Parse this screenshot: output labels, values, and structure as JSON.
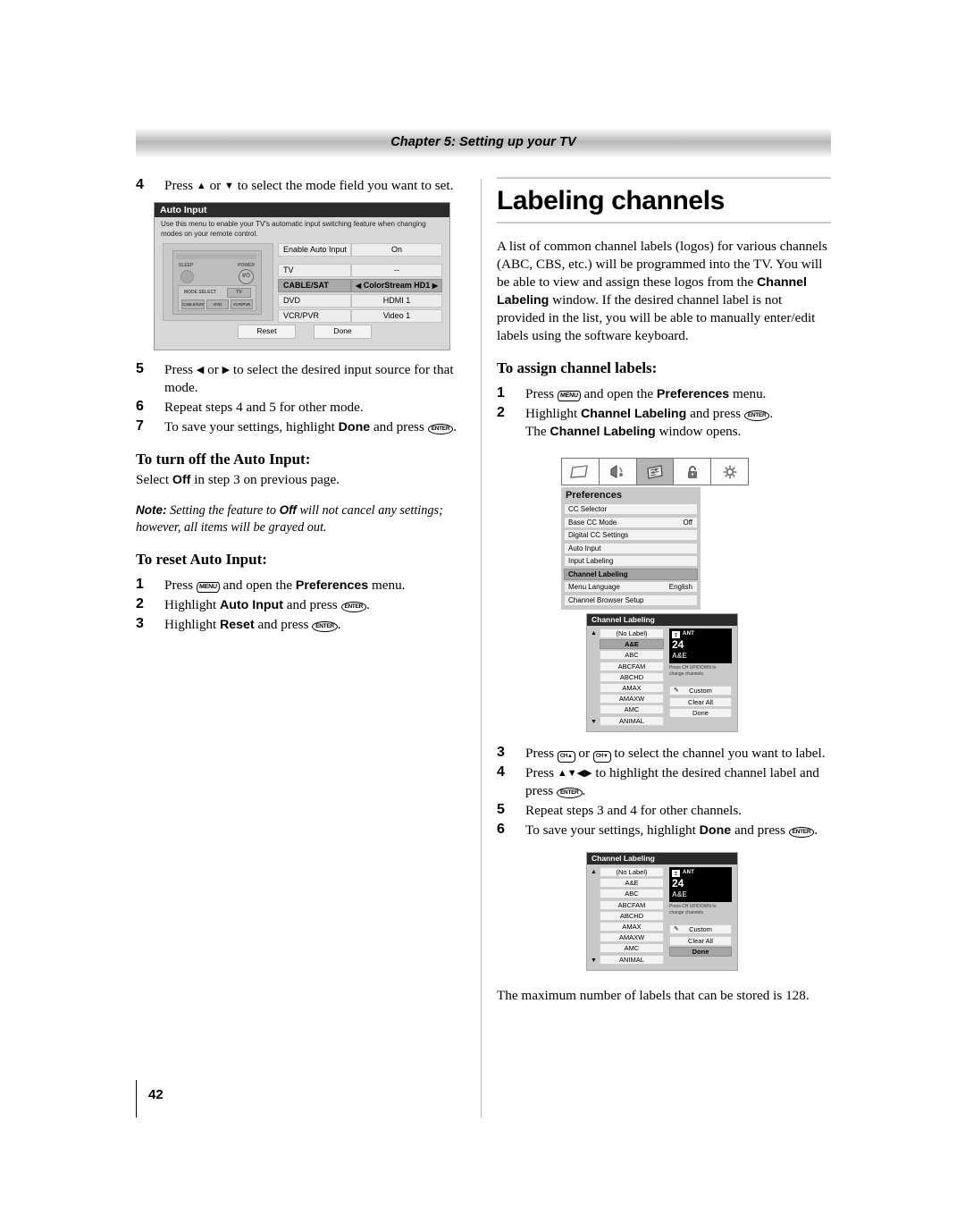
{
  "header": {
    "chapter": "Chapter 5: Setting up your TV"
  },
  "page": {
    "number": "42"
  },
  "left": {
    "step4": {
      "num": "4",
      "pre": "Press ",
      "mid": " or ",
      "post": " to select the mode field you want to set."
    },
    "step5": {
      "num": "5",
      "pre": "Press ",
      "mid": " or ",
      "post": " to select the desired input source for that mode."
    },
    "step6": {
      "num": "6",
      "text": "Repeat steps 4 and 5 for other mode."
    },
    "step7": {
      "num": "7",
      "pre": "To save your settings, highlight ",
      "bold": "Done",
      "post": " and press ",
      "key": "ENTER"
    },
    "heading_turnoff": "To turn off the Auto Input:",
    "turnoff_pre": "Select ",
    "turnoff_bold": "Off",
    "turnoff_post": " in step 3 on previous page.",
    "note_label": "Note:",
    "note_pre": " Setting the feature to ",
    "note_bold": "Off",
    "note_post": " will not cancel any settings; however, all items will be grayed out.",
    "heading_reset": "To reset Auto Input:",
    "r1": {
      "num": "1",
      "pre": "Press ",
      "key": "MENU",
      "mid": " and open the ",
      "bold": "Preferences",
      "post": " menu."
    },
    "r2": {
      "num": "2",
      "pre": "Highlight ",
      "bold": "Auto Input",
      "mid": " and press ",
      "key": "ENTER",
      "post": "."
    },
    "r3": {
      "num": "3",
      "pre": "Highlight ",
      "bold": "Reset",
      "mid": " and press ",
      "key": "ENTER",
      "post": "."
    }
  },
  "auto_input_osd": {
    "title": "Auto Input",
    "description": "Use this menu to enable your TV's automatic input switching feature when changing modes on your remote control.",
    "remote": {
      "sleep_label": "SLEEP",
      "power_label": "POWER",
      "power_glyph": "I/⏻",
      "mode_select_label": "MODE SELECT",
      "tv_button": "TV",
      "buttons": [
        "CABLE/SAT",
        "DVD",
        "VCR/PVR"
      ]
    },
    "enable_row": {
      "label": "Enable Auto Input",
      "value": "On"
    },
    "rows": [
      {
        "label": "TV",
        "value": "--",
        "selected": false
      },
      {
        "label": "CABLE/SAT",
        "value": "ColorStream HD1",
        "selected": true
      },
      {
        "label": "DVD",
        "value": "HDMI 1",
        "selected": false
      },
      {
        "label": "VCR/PVR",
        "value": "Video 1",
        "selected": false
      }
    ],
    "buttons": [
      "Reset",
      "Done"
    ],
    "arrow_left": "◀",
    "arrow_right": "▶"
  },
  "right": {
    "title": "Labeling channels",
    "intro_1": "A list of common channel labels (logos) for various channels (ABC, CBS, etc.) will be programmed into the TV. You will be able to view and assign these logos from the ",
    "intro_b1": "Channel Labeling",
    "intro_2": " window. If the desired channel label is not provided in the list, you will be able to manually enter/edit labels using the software keyboard.",
    "heading_assign": "To assign channel labels:",
    "a1": {
      "num": "1",
      "pre": "Press ",
      "key": "MENU",
      "mid": " and open the ",
      "bold": "Preferences",
      "post": " menu."
    },
    "a2": {
      "num": "2",
      "pre": "Highlight ",
      "bold": "Channel Labeling",
      "mid": " and press ",
      "key": "ENTER",
      "post": "."
    },
    "a2_sub_pre": "The ",
    "a2_sub_bold": "Channel Labeling",
    "a2_sub_post": " window opens.",
    "a3": {
      "num": "3",
      "pre": "Press ",
      "k1": "CH▲",
      "mid": " or ",
      "k2": "CH▼",
      "post": " to select the channel you want to label."
    },
    "a4": {
      "num": "4",
      "pre": "Press ",
      "arrows": "▲▼◀▶",
      "mid": " to highlight the desired channel label and press ",
      "key": "ENTER",
      "post": "."
    },
    "a5": {
      "num": "5",
      "text": "Repeat steps 3 and 4 for other channels."
    },
    "a6": {
      "num": "6",
      "pre": "To save your settings, highlight ",
      "bold": "Done",
      "mid": " and press ",
      "key": "ENTER",
      "post": "."
    },
    "tail": "The maximum number of labels that can be stored is 128."
  },
  "preferences_osd": {
    "icons": [
      "picture-icon",
      "audio-icon",
      "preferences-icon",
      "lock-icon",
      "brightness-icon"
    ],
    "selected_icon_index": 2,
    "title": "Preferences",
    "items": [
      {
        "label": "CC Selector",
        "value": "",
        "selected": false
      },
      {
        "label": "Base CC Mode",
        "value": "Off",
        "selected": false
      },
      {
        "label": "Digital CC Settings",
        "value": "",
        "selected": false
      },
      {
        "label": "Auto Input",
        "value": "",
        "selected": false
      },
      {
        "label": "Input Labeling",
        "value": "",
        "selected": false
      },
      {
        "label": "Channel Labeling",
        "value": "",
        "selected": true
      },
      {
        "label": "Menu Language",
        "value": "English",
        "selected": false
      },
      {
        "label": "Channel Browser Setup",
        "value": "",
        "selected": false
      }
    ]
  },
  "channel_labeling_osd_1": {
    "title": "Channel Labeling",
    "scroll_up": "▲",
    "scroll_down": "▼",
    "labels": [
      {
        "text": "(No Label)",
        "selected": false
      },
      {
        "text": "A&E",
        "selected": true
      },
      {
        "text": "ABC",
        "selected": false
      },
      {
        "text": "ABCFAM",
        "selected": false
      },
      {
        "text": "ABCHD",
        "selected": false
      },
      {
        "text": "AMAX",
        "selected": false
      },
      {
        "text": "AMAXW",
        "selected": false
      },
      {
        "text": "AMC",
        "selected": false
      },
      {
        "text": "ANIMAL",
        "selected": false
      }
    ],
    "preview": {
      "source": "ANT",
      "channel": "24",
      "label": "A&E"
    },
    "hint": "Press CH UP/DOWN to change channels.",
    "buttons": [
      {
        "text": "Custom",
        "icon": "pencil-icon",
        "selected": false
      },
      {
        "text": "Clear All",
        "icon": "",
        "selected": false
      },
      {
        "text": "Done",
        "icon": "",
        "selected": false
      }
    ]
  },
  "channel_labeling_osd_2": {
    "title": "Channel Labeling",
    "scroll_up": "▲",
    "scroll_down": "▼",
    "labels": [
      {
        "text": "(No Label)",
        "selected": false
      },
      {
        "text": "A&E",
        "selected": false
      },
      {
        "text": "ABC",
        "selected": false
      },
      {
        "text": "ABCFAM",
        "selected": false
      },
      {
        "text": "ABCHD",
        "selected": false
      },
      {
        "text": "AMAX",
        "selected": false
      },
      {
        "text": "AMAXW",
        "selected": false
      },
      {
        "text": "AMC",
        "selected": false
      },
      {
        "text": "ANIMAL",
        "selected": false
      }
    ],
    "preview": {
      "source": "ANT",
      "channel": "24",
      "label": "A&E"
    },
    "hint": "Press CH UP/DOWN to change channels.",
    "buttons": [
      {
        "text": "Custom",
        "icon": "pencil-icon",
        "selected": false
      },
      {
        "text": "Clear All",
        "icon": "",
        "selected": false
      },
      {
        "text": "Done",
        "icon": "",
        "selected": true
      }
    ]
  },
  "colors": {
    "osd_dark": "#2b2b2b",
    "osd_gray": "#c9c9c9",
    "highlight": "#a5a5a5"
  }
}
